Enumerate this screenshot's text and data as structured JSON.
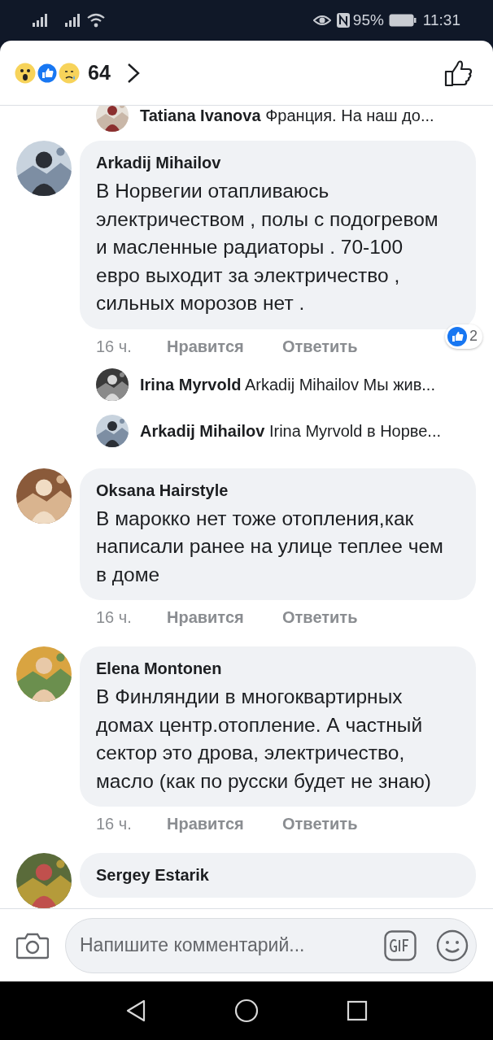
{
  "status_bar": {
    "battery": "95%",
    "time": "11:31"
  },
  "header": {
    "reaction_count": "64"
  },
  "comments": [
    {
      "kind": "reply",
      "author": "Tatiana Ivanova",
      "text": "Франция. На наш до..."
    },
    {
      "kind": "comment",
      "author": "Arkadij Mihailov",
      "text": "В Норвегии отапливаюсь электричеством , полы с подогревом и масленные радиаторы . 70-100 евро выходит за электричество , сильных морозов нет .",
      "time": "16 ч.",
      "like": "Нравится",
      "reply": "Ответить",
      "reactions": "2"
    },
    {
      "kind": "reply",
      "author": "Irina Myrvold",
      "text": "Arkadij Mihailov Мы жив..."
    },
    {
      "kind": "reply",
      "author": "Arkadij Mihailov",
      "text": "Irina Myrvold в Норве..."
    },
    {
      "kind": "comment",
      "author": "Oksana Hairstyle",
      "text": "В марокко нет тоже отопления,как написали ранее на улице теплее чем в доме",
      "time": "16 ч.",
      "like": "Нравится",
      "reply": "Ответить"
    },
    {
      "kind": "comment",
      "author": "Elena Montonen",
      "text": "В Финляндии в многоквартирных домах центр.отопление. А частный сектор это дрова, электричество, масло (как по русски будет не знаю)",
      "time": "16 ч.",
      "like": "Нравится",
      "reply": "Ответить"
    },
    {
      "kind": "comment",
      "author": "Sergey Estarik"
    }
  ],
  "composer": {
    "placeholder": "Напишите комментарий..."
  }
}
